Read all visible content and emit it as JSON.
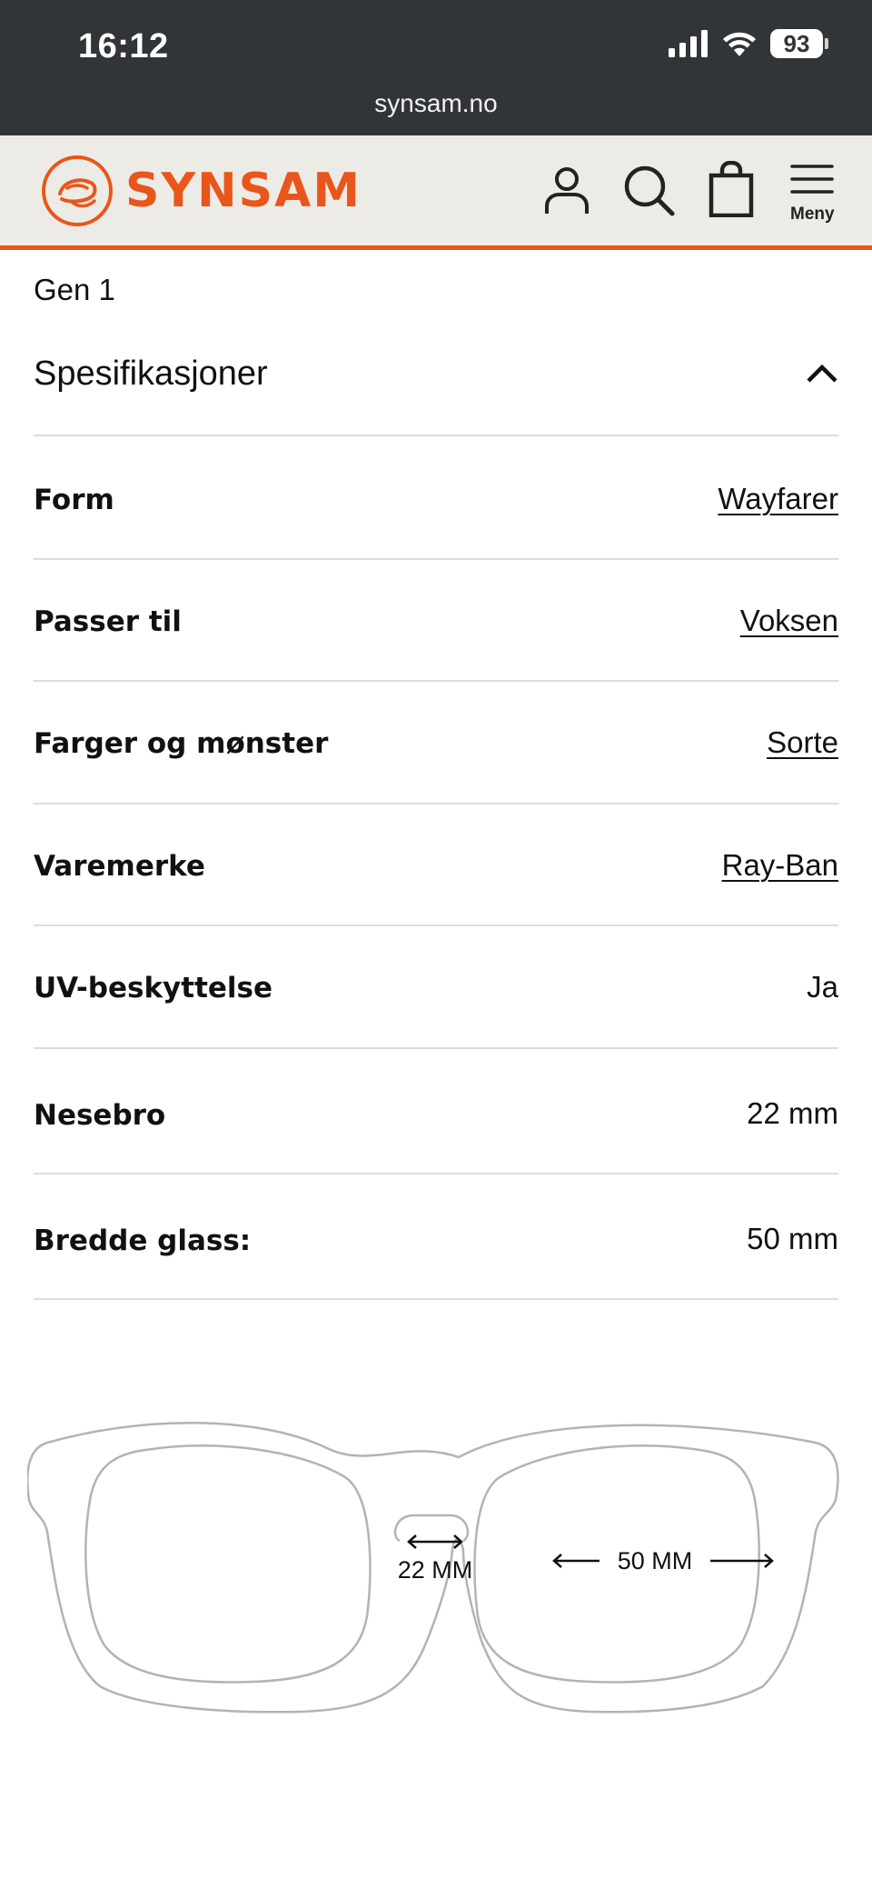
{
  "status_bar": {
    "time": "16:12",
    "battery": "93"
  },
  "browser": {
    "url": "synsam.no"
  },
  "header": {
    "logo_text": "SYNSAM",
    "menu_label": "Meny",
    "icons": [
      "user-icon",
      "search-icon",
      "bag-icon",
      "hamburger-icon"
    ],
    "accent_color": "#e8561b"
  },
  "product": {
    "variant": "Gen 1"
  },
  "specs": {
    "title": "Spesifikasjoner",
    "rows": [
      {
        "label": "Form",
        "value": "Wayfarer",
        "link": true
      },
      {
        "label": "Passer til",
        "value": "Voksen",
        "link": true
      },
      {
        "label": "Farger og mønster",
        "value": "Sorte",
        "link": true
      },
      {
        "label": "Varemerke",
        "value": "Ray-Ban",
        "link": true
      },
      {
        "label": "UV-beskyttelse",
        "value": "Ja",
        "link": false
      },
      {
        "label": "Nesebro",
        "value": "22 mm",
        "link": false
      },
      {
        "label": "Bredde glass:",
        "value": "50 mm",
        "link": false
      }
    ]
  },
  "diagram": {
    "bridge_label": "22 MM",
    "lens_label": "50 MM"
  }
}
